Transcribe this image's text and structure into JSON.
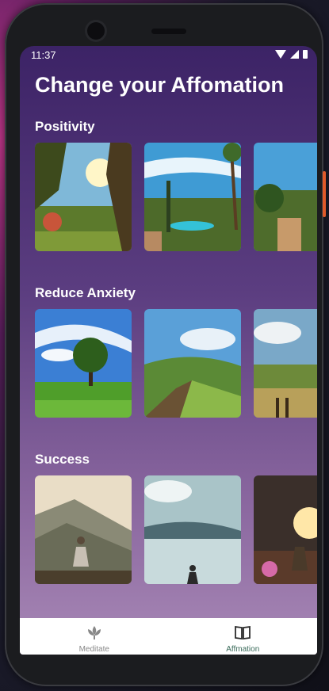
{
  "status": {
    "time": "11:37"
  },
  "page_title": "Change your Affomation",
  "sections": [
    {
      "title": "Positivity"
    },
    {
      "title": "Reduce Anxiety"
    },
    {
      "title": "Success"
    }
  ],
  "nav": {
    "items": [
      {
        "label": "Meditate",
        "icon": "lotus-icon",
        "active": false
      },
      {
        "label": "Affmation",
        "icon": "book-icon",
        "active": true
      }
    ]
  },
  "colors": {
    "accent": "#3a6b5a",
    "inactive": "#888888"
  }
}
